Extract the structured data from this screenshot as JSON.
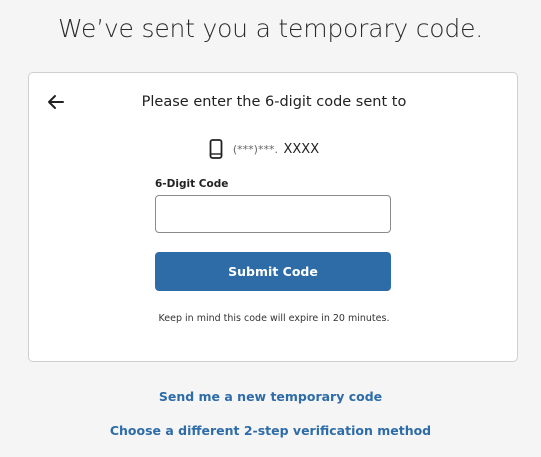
{
  "headline": "We’ve sent you a temporary code.",
  "card": {
    "back_icon": "back-arrow-icon",
    "prompt": "Please enter the 6-digit code sent to",
    "phone_icon": "mobile-phone-icon",
    "phone_masked_prefix": "(***)***.",
    "phone_last": "XXXX",
    "field_label": "6-Digit Code",
    "field_value": "",
    "submit_label": "Submit Code",
    "note": "Keep in mind this code will expire in 20 minutes."
  },
  "links": {
    "resend": "Send me a new temporary code",
    "different_method": "Choose a different 2-step verification method"
  },
  "colors": {
    "accent": "#2e6ca8",
    "background": "#f5f5f5",
    "card": "#ffffff"
  }
}
